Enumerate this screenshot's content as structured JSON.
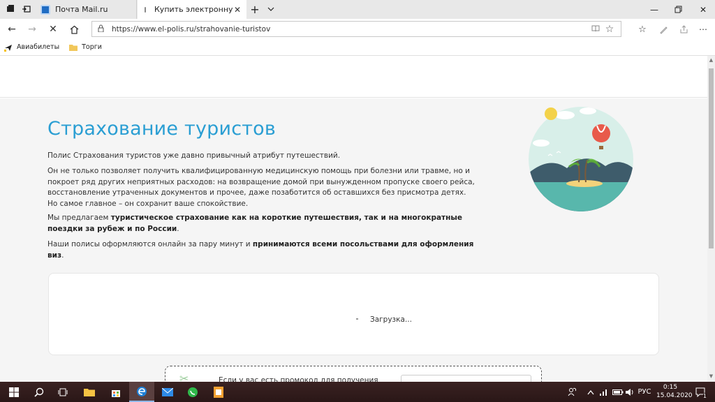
{
  "browser": {
    "tabs": [
      {
        "title": "Почта Mail.ru",
        "active": false
      },
      {
        "title": "Купить электронную ст",
        "active": true
      }
    ],
    "url": "https://www.el-polis.ru/strahovanie-turistov",
    "favorites": [
      "Авиабилеты",
      "Торги"
    ]
  },
  "page": {
    "title": "Страхование туристов",
    "intro": "Полис Страхования туристов уже давно привычный атрибут путешествий.",
    "p2": "Он не только позволяет получить квалифицированную медицинскую помощь при болезни или травме, но и покроет ряд других неприятных расходов: на возвращение домой при вынужденном пропуске своего рейса, восстановление утраченных документов и прочее, даже позаботится об оставшихся без присмотра детях. Но самое главное – он сохранит ваше спокойствие.",
    "p3_lead": "Мы предлагаем ",
    "p3_bold": "туристическое страхование как на короткие путешествия, так и на многократные поездки за рубеж и по России",
    "p3_end": ".",
    "p4_lead": "Наши полисы оформляются онлайн за пару минут и ",
    "p4_bold": "принимаются всеми посольствами для оформления виз",
    "p4_end": ".",
    "loading": "Загрузка...",
    "promo_text": "Если у вас есть промокод для получения"
  },
  "taskbar": {
    "lang": "РУС",
    "time": "0:15",
    "date": "15.04.2020",
    "notifications": "1"
  },
  "colors": {
    "accent": "#2a9ed3",
    "tab_active": "#ffffff",
    "taskbar": "#2a1717"
  }
}
